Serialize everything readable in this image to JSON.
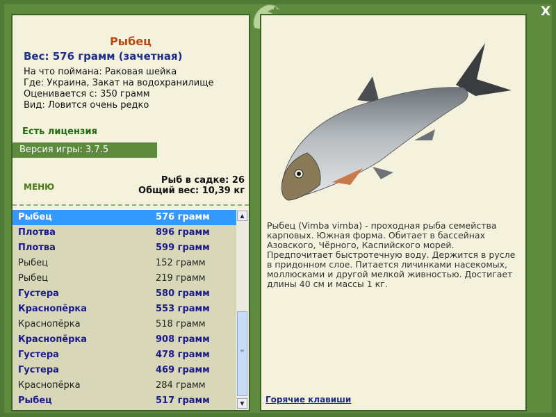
{
  "fish": {
    "name": "Рыбец",
    "weight": "Вес: 576 грамм (зачетная)",
    "info": [
      "На что поймана: Раковая шейка",
      "Где: Украина, Закат на водохранилище",
      "Оценивается с: 350 грамм",
      "Вид: Ловится очень редко"
    ],
    "license": "Есть лицензия",
    "version": "Версия игры: 3.7.5",
    "description": "Рыбец (Vimba vimba) - проходная рыба семейства карповых. Южная форма. Обитает в бассейнах Азовского, Чёрного, Каспийского морей. Предпочитает быстротечную воду. Держится в русле в придонном слое. Питается личинками насекомых, моллюсками и другой мелкой живностью. Достигает длины 40 см и массы 1 кг."
  },
  "menu_label": "МЕНЮ",
  "stats": {
    "count": "Рыб в садке: 26",
    "total": "Общий вес: 10,39 кг"
  },
  "catch_list": [
    {
      "name": "Рыбец",
      "weight": "576 грамм",
      "style": "selected"
    },
    {
      "name": "Плотва",
      "weight": "896 грамм",
      "style": "bold"
    },
    {
      "name": "Плотва",
      "weight": "599 грамм",
      "style": "bold"
    },
    {
      "name": "Рыбец",
      "weight": "152 грамм",
      "style": "plain"
    },
    {
      "name": "Рыбец",
      "weight": "219 грамм",
      "style": "plain"
    },
    {
      "name": "Густера",
      "weight": "580 грамм",
      "style": "bold"
    },
    {
      "name": "Краснопёрка",
      "weight": "553 грамм",
      "style": "bold"
    },
    {
      "name": "Краснопёрка",
      "weight": "518 грамм",
      "style": "plain"
    },
    {
      "name": "Краснопёрка",
      "weight": "908 грамм",
      "style": "bold"
    },
    {
      "name": "Густера",
      "weight": "478 грамм",
      "style": "bold"
    },
    {
      "name": "Густера",
      "weight": "469 грамм",
      "style": "bold"
    },
    {
      "name": "Краснопёрка",
      "weight": "284 грамм",
      "style": "plain"
    },
    {
      "name": "Рыбец",
      "weight": "517 грамм",
      "style": "bold"
    }
  ],
  "hotkeys_label": "Горячие клавиши",
  "close_label": "X",
  "icons": {
    "close": "close-icon",
    "logo": "fish-logo-icon",
    "scroll_up": "arrow-up-icon",
    "scroll_down": "arrow-down-icon"
  },
  "colors": {
    "frame": "#4f7a33",
    "panel": "#f4f1dc",
    "title": "#b84a10",
    "selected": "#3399ff"
  }
}
